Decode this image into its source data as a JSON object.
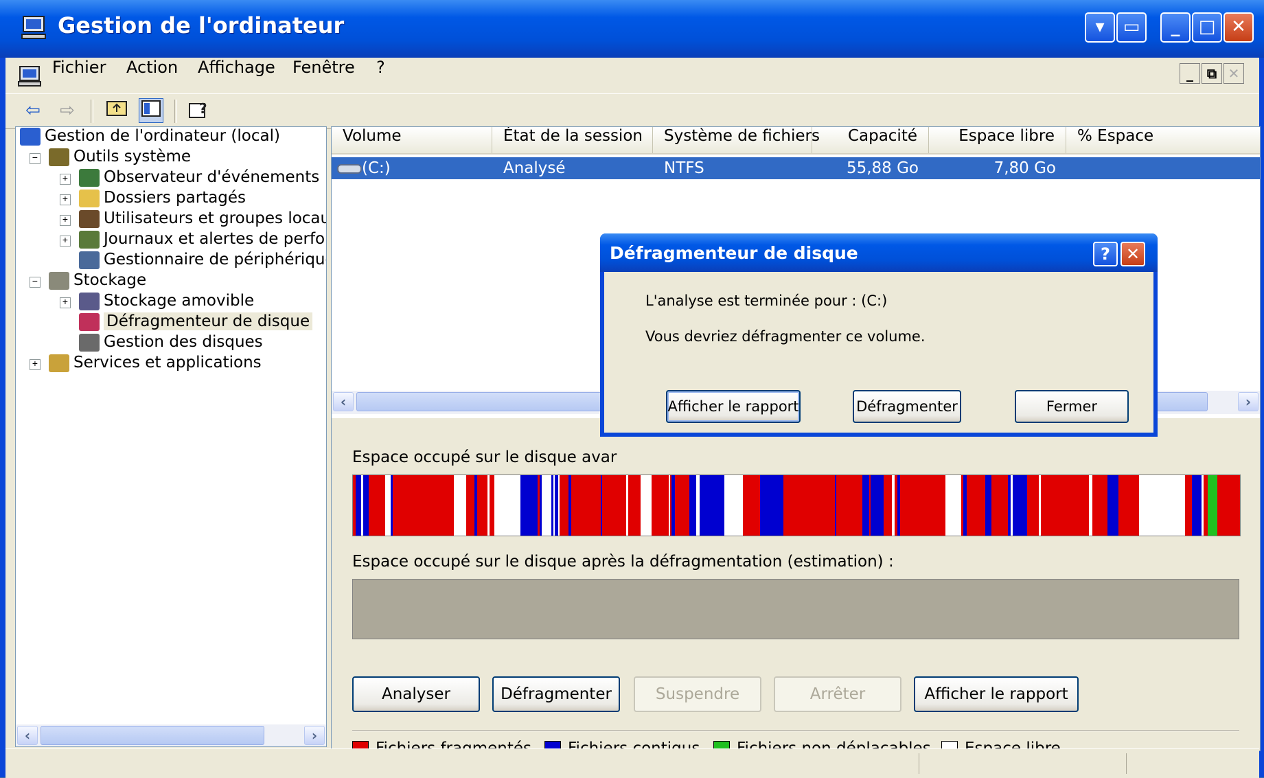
{
  "window": {
    "title": "Gestion de l'ordinateur"
  },
  "menu": {
    "items": [
      "Fichier",
      "Action",
      "Affichage",
      "Fenêtre",
      "?"
    ]
  },
  "tree": {
    "nodes": [
      {
        "label": "Gestion de l'ordinateur (local)",
        "icon": "computer-icon"
      },
      {
        "label": "Outils système",
        "icon": "tools-icon"
      },
      {
        "label": "Observateur d'événements",
        "icon": "event-viewer-icon"
      },
      {
        "label": "Dossiers partagés",
        "icon": "shared-folder-icon"
      },
      {
        "label": "Utilisateurs et groupes locau:",
        "icon": "users-icon"
      },
      {
        "label": "Journaux et alertes de perfo",
        "icon": "perf-logs-icon"
      },
      {
        "label": "Gestionnaire de périphérique",
        "icon": "device-manager-icon"
      },
      {
        "label": "Stockage",
        "icon": "storage-icon"
      },
      {
        "label": "Stockage amovible",
        "icon": "removable-storage-icon"
      },
      {
        "label": "Défragmenteur de disque",
        "icon": "defrag-icon"
      },
      {
        "label": "Gestion des disques",
        "icon": "disk-management-icon"
      },
      {
        "label": "Services et applications",
        "icon": "services-icon"
      }
    ]
  },
  "list": {
    "columns": [
      "Volume",
      "État de la session",
      "Système de fichiers",
      "Capacité",
      "Espace libre",
      "% Espace"
    ],
    "rows": [
      [
        "(C:)",
        "Analysé",
        "NTFS",
        "55,88 Go",
        "7,80 Go"
      ]
    ]
  },
  "defrag": {
    "before_label": "Espace occupé sur le disque avar",
    "after_label": "Espace occupé sur le disque après la défragmentation (estimation) :",
    "buttons": [
      "Analyser",
      "Défragmenter",
      "Suspendre",
      "Arrêter",
      "Afficher le rapport"
    ],
    "legend": [
      "Fichiers fragmentés",
      "Fichiers contigus",
      "Fichiers non déplaçables",
      "Espace libre"
    ]
  },
  "colors": {
    "fragmented": "#e00000",
    "contiguous": "#0000d0",
    "unmovable": "#20c020",
    "free": "#ffffff"
  },
  "dialog": {
    "title": "Défragmenteur de disque",
    "line1": "L'analyse est terminée pour : (C:)",
    "line2": "Vous devriez défragmenter ce volume.",
    "buttons": [
      "Afficher le rapport",
      "Défragmenter",
      "Fermer"
    ]
  }
}
